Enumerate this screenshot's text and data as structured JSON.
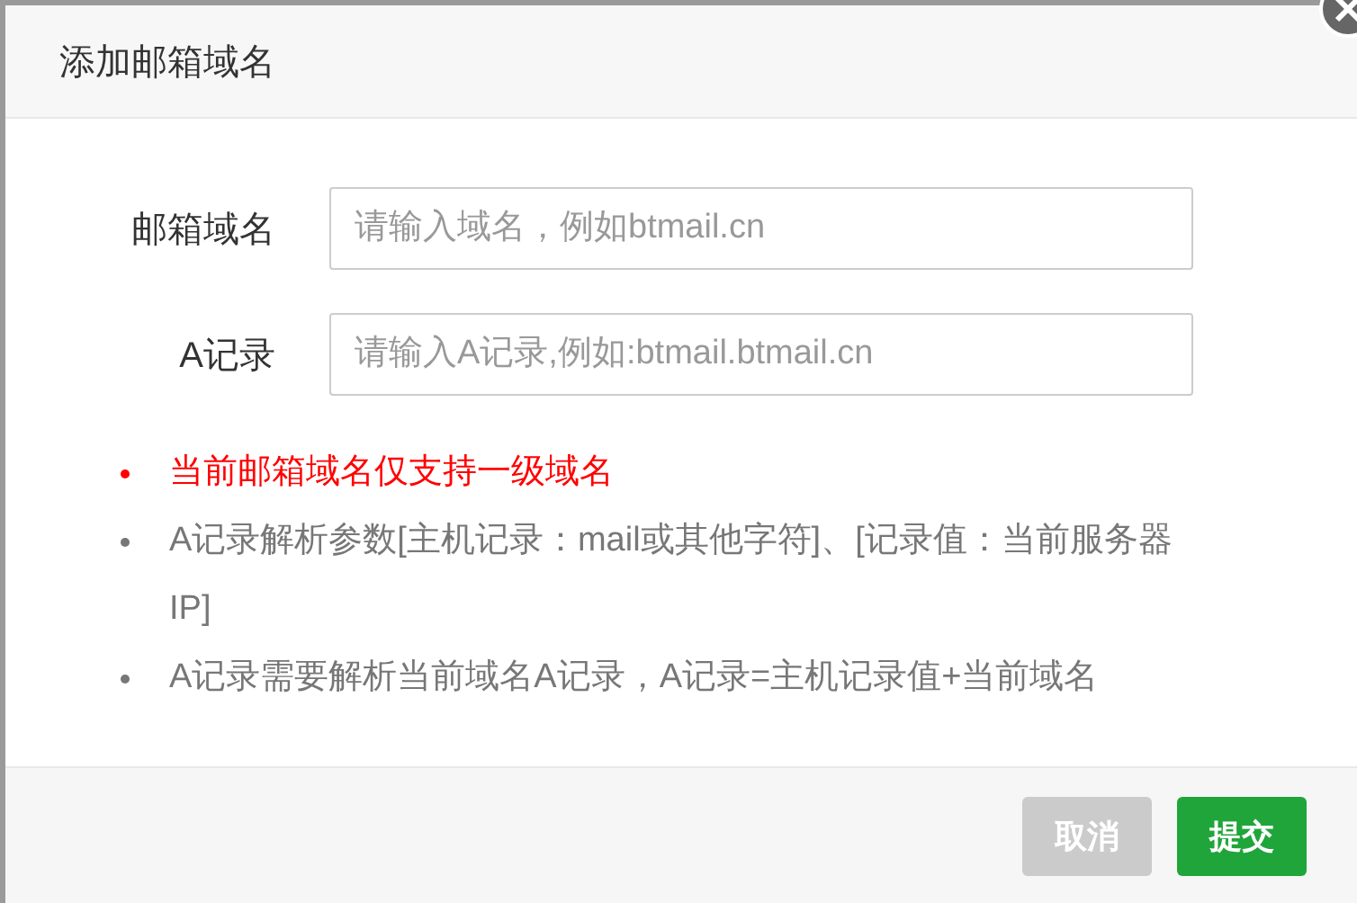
{
  "dialog": {
    "title": "添加邮箱域名",
    "fields": [
      {
        "label": "邮箱域名",
        "placeholder": "请输入域名，例如btmail.cn"
      },
      {
        "label": "A记录",
        "placeholder": "请输入A记录,例如:btmail.btmail.cn"
      }
    ],
    "notes": [
      {
        "kind": "warning",
        "text": "当前邮箱域名仅支持一级域名"
      },
      {
        "kind": "info",
        "text": "A记录解析参数[主机记录：mail或其他字符]、[记录值：当前服务器IP]"
      },
      {
        "kind": "info",
        "text": "A记录需要解析当前域名A记录，A记录=主机记录值+当前域名"
      }
    ],
    "buttons": [
      {
        "label": "取消",
        "kind": "cancel"
      },
      {
        "label": "提交",
        "kind": "primary"
      }
    ]
  }
}
